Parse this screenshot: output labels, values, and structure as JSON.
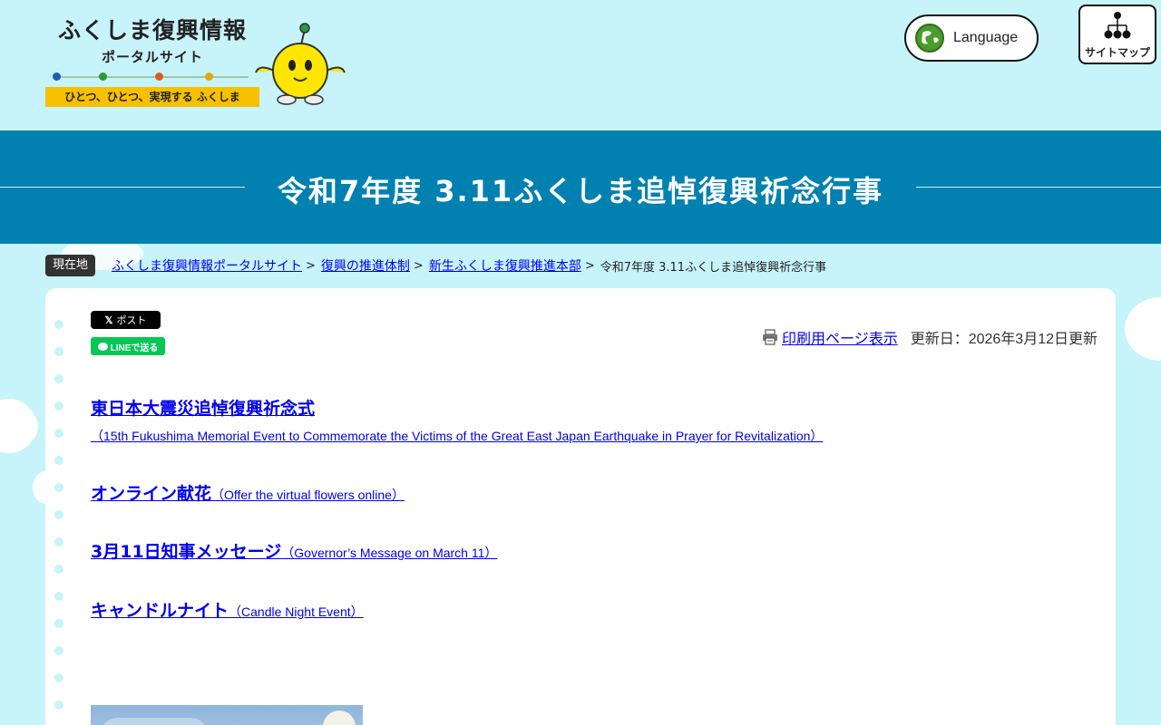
{
  "header": {
    "logo": {
      "title": "ふくしま復興情報",
      "subtitle": "ポータルサイト",
      "tagline": "ひとつ、ひとつ、実現する ふくしま",
      "dot_colors": [
        "#1f5fb0",
        "#2a9a3a",
        "#e05a20",
        "#e6a800"
      ]
    },
    "language_label": "Language",
    "sitemap_label": "サイトマップ"
  },
  "banner": {
    "title": "令和7年度 3.11ふくしま追悼復興祈念行事"
  },
  "breadcrumb": {
    "here_label": "現在地",
    "items": [
      {
        "label": "ふくしま復興情報ポータルサイト"
      },
      {
        "label": "復興の推進体制"
      },
      {
        "label": "新生ふくしま復興推進本部"
      }
    ],
    "separator": ">",
    "current": "令和7年度 3.11ふくしま追悼復興祈念行事"
  },
  "share": {
    "x_post_label": "ポスト",
    "line_label": "LINEで送る"
  },
  "print": {
    "label": "印刷用ページ表示",
    "updated": "更新日：2026年3月12日更新"
  },
  "links": [
    {
      "title": "東日本大震災追悼復興祈念式",
      "subtitle": "（15th Fukushima Memorial Event to Commemorate the Victims of the Great East Japan Earthquake in Prayer for Revitalization）"
    },
    {
      "title": "オンライン献花",
      "subtitle": "（Offer the virtual flowers online）"
    },
    {
      "title": "3月11日知事メッセージ",
      "subtitle": "（Governor’s Message on March 11）"
    },
    {
      "title": "キャンドルナイト",
      "subtitle": "（Candle Night Event）"
    }
  ],
  "colors": {
    "page_bg": "#c7f4fa",
    "banner_bg": "#0081b0",
    "link": "#0000ee",
    "tagline_bg": "#f6c000",
    "line_green": "#06c755"
  }
}
